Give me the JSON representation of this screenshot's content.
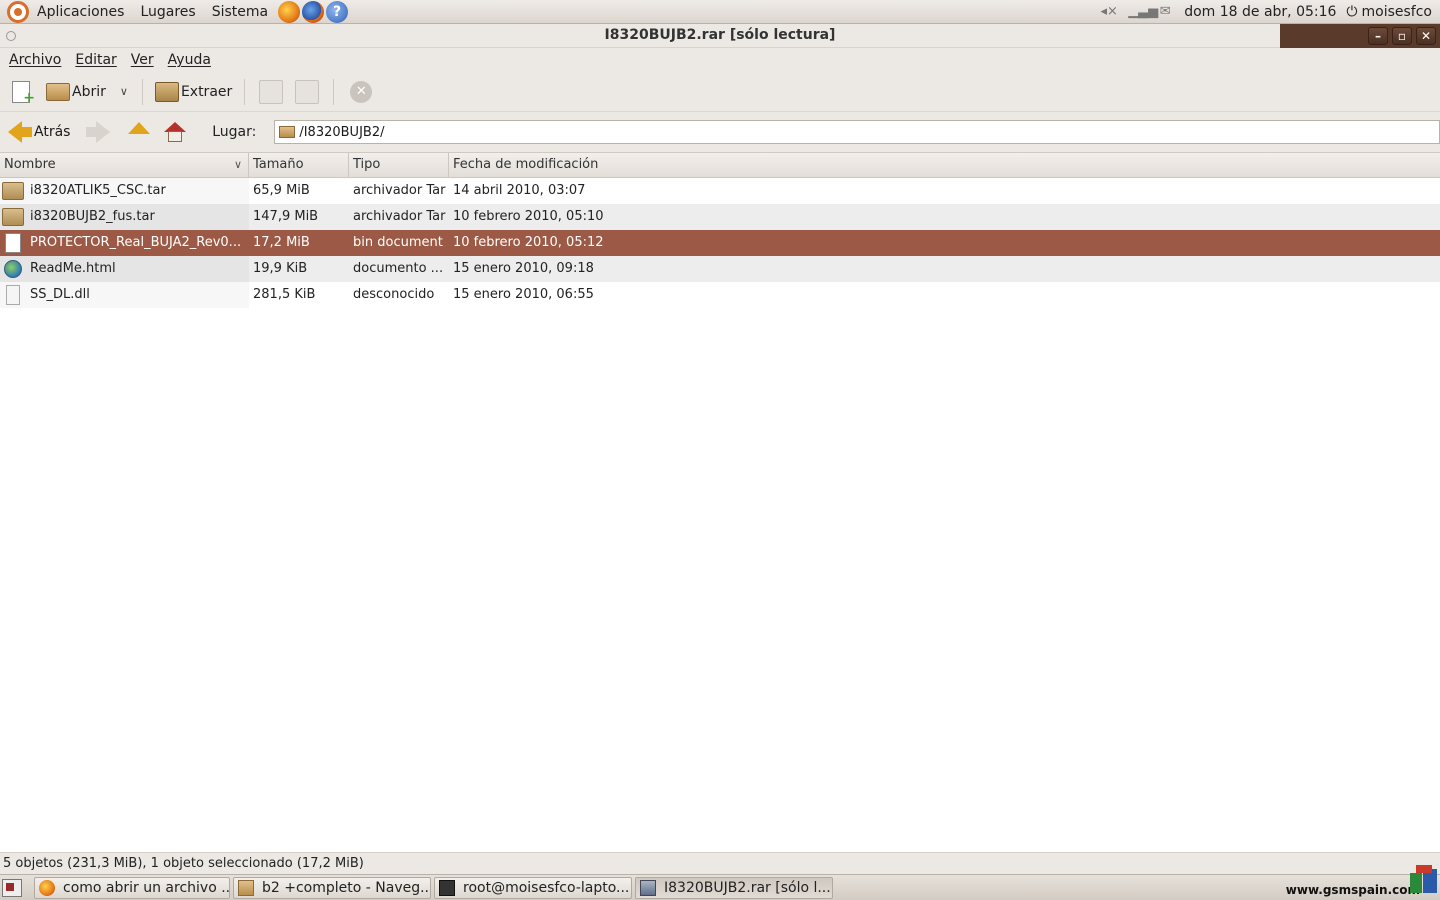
{
  "top_panel": {
    "menus": [
      "Aplicaciones",
      "Lugares",
      "Sistema"
    ],
    "launchers": [
      "firefox-icon",
      "firefox-alt-icon",
      "help-icon"
    ],
    "clock": "dom 18 de abr, 05:16",
    "user": "moisesfco"
  },
  "window": {
    "title": "I8320BUJB2.rar [sólo lectura]"
  },
  "menubar": {
    "archivo": "Archivo",
    "editar": "Editar",
    "ver": "Ver",
    "ayuda": "Ayuda"
  },
  "toolbar": {
    "open_label": "Abrir",
    "extract_label": "Extraer"
  },
  "location": {
    "back_label": "Atrás",
    "lugar_label": "Lugar:",
    "path": "/I8320BUJB2/"
  },
  "table": {
    "headers": {
      "name": "Nombre",
      "size": "Tamaño",
      "type": "Tipo",
      "date": "Fecha de modificación"
    },
    "rows": [
      {
        "name": "i8320ATLIK5_CSC.tar",
        "size": "65,9 MiB",
        "type": "archivador Tar",
        "date": "14 abril 2010, 03:07",
        "icon": "archive"
      },
      {
        "name": "i8320BUJB2_fus.tar",
        "size": "147,9 MiB",
        "type": "archivador Tar",
        "date": "10 febrero 2010, 05:10",
        "icon": "archive"
      },
      {
        "name": "PROTECTOR_Real_BUJA2_Rev0...",
        "size": "17,2 MiB",
        "type": "bin document",
        "date": "10 febrero 2010, 05:12",
        "icon": "doc",
        "selected": true
      },
      {
        "name": "ReadMe.html",
        "size": "19,9 KiB",
        "type": "documento ...",
        "date": "15 enero 2010, 09:18",
        "icon": "html"
      },
      {
        "name": "SS_DL.dll",
        "size": "281,5 KiB",
        "type": "desconocido",
        "date": "15 enero 2010, 06:55",
        "icon": "unknown"
      }
    ]
  },
  "status": {
    "text": "5 objetos (231,3 MiB), 1 objeto seleccionado (17,2 MiB)"
  },
  "taskbar": {
    "tasks": [
      {
        "label": "como abrir un archivo ...",
        "icon": "firefox-icon"
      },
      {
        "label": "b2 +completo - Naveg...",
        "icon": "folder-icon"
      },
      {
        "label": "root@moisesfco-lapto...",
        "icon": "terminal-icon"
      },
      {
        "label": "I8320BUJB2.rar [sólo l...",
        "icon": "archive-manager-icon"
      }
    ],
    "watermark": "www.gsmspain.com"
  },
  "colors": {
    "selection": "#9c5a46",
    "accent_orange": "#d76f2a",
    "window_controls": "#5a3a2b"
  }
}
